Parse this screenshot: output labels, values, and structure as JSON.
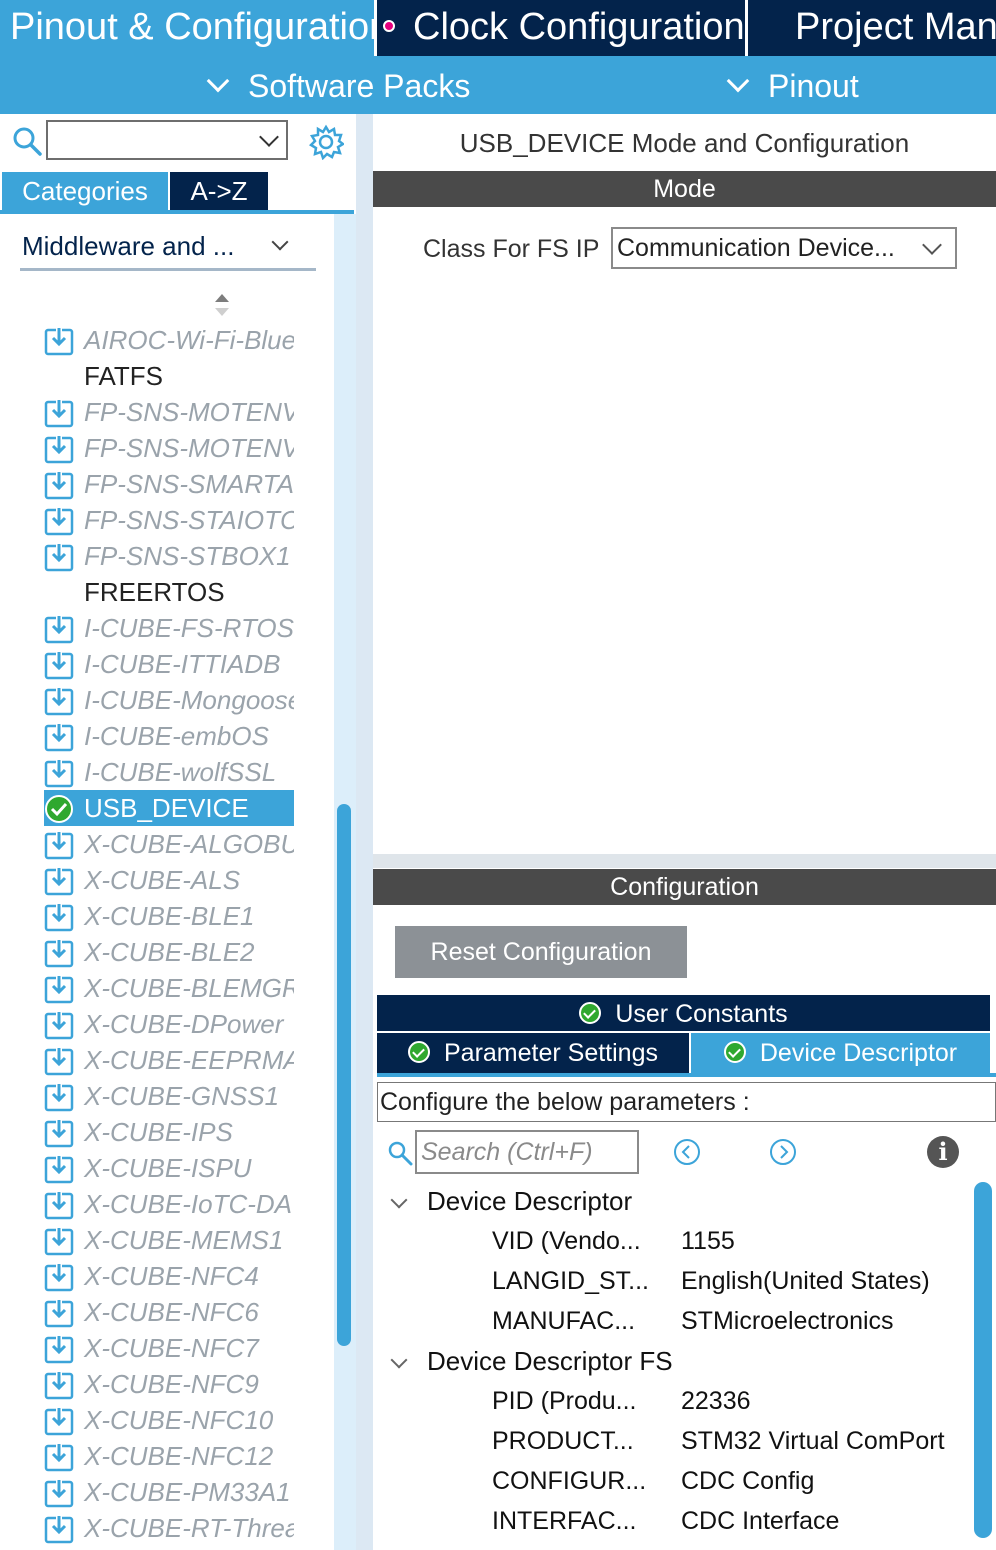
{
  "top_tabs": [
    {
      "label": "Pinout & Configuration"
    },
    {
      "label": "Clock Configuration"
    },
    {
      "label": "Project Man"
    }
  ],
  "sub_nav": [
    {
      "label": "Software Packs"
    },
    {
      "label": "Pinout"
    }
  ],
  "left": {
    "search_value": "",
    "category_tabs": [
      {
        "label": "Categories"
      },
      {
        "label": "A->Z"
      }
    ],
    "category_select": "Middleware and ...",
    "items": [
      {
        "label": "AIROC-Wi-Fi-Blue",
        "state": "download"
      },
      {
        "label": "FATFS",
        "state": "plain"
      },
      {
        "label": "FP-SNS-MOTENV",
        "state": "download"
      },
      {
        "label": "FP-SNS-MOTENV",
        "state": "download"
      },
      {
        "label": "FP-SNS-SMARTA",
        "state": "download"
      },
      {
        "label": "FP-SNS-STAIOTC",
        "state": "download"
      },
      {
        "label": "FP-SNS-STBOX1",
        "state": "download"
      },
      {
        "label": "FREERTOS",
        "state": "plain"
      },
      {
        "label": "I-CUBE-FS-RTOS",
        "state": "download"
      },
      {
        "label": "I-CUBE-ITTIADB",
        "state": "download"
      },
      {
        "label": "I-CUBE-Mongoose",
        "state": "download"
      },
      {
        "label": "I-CUBE-embOS",
        "state": "download"
      },
      {
        "label": "I-CUBE-wolfSSL",
        "state": "download"
      },
      {
        "label": "USB_DEVICE",
        "state": "selected"
      },
      {
        "label": "X-CUBE-ALGOBU",
        "state": "download"
      },
      {
        "label": "X-CUBE-ALS",
        "state": "download"
      },
      {
        "label": "X-CUBE-BLE1",
        "state": "download"
      },
      {
        "label": "X-CUBE-BLE2",
        "state": "download"
      },
      {
        "label": "X-CUBE-BLEMGR",
        "state": "download"
      },
      {
        "label": "X-CUBE-DPower",
        "state": "download"
      },
      {
        "label": "X-CUBE-EEPRMA",
        "state": "download"
      },
      {
        "label": "X-CUBE-GNSS1",
        "state": "download"
      },
      {
        "label": "X-CUBE-IPS",
        "state": "download"
      },
      {
        "label": "X-CUBE-ISPU",
        "state": "download"
      },
      {
        "label": "X-CUBE-IoTC-DA",
        "state": "download"
      },
      {
        "label": "X-CUBE-MEMS1",
        "state": "download"
      },
      {
        "label": "X-CUBE-NFC4",
        "state": "download"
      },
      {
        "label": "X-CUBE-NFC6",
        "state": "download"
      },
      {
        "label": "X-CUBE-NFC7",
        "state": "download"
      },
      {
        "label": "X-CUBE-NFC9",
        "state": "download"
      },
      {
        "label": "X-CUBE-NFC10",
        "state": "download"
      },
      {
        "label": "X-CUBE-NFC12",
        "state": "download"
      },
      {
        "label": "X-CUBE-PM33A1",
        "state": "download"
      },
      {
        "label": "X-CUBE-RT-Threa",
        "state": "download"
      }
    ]
  },
  "right": {
    "title": "USB_DEVICE Mode and Configuration",
    "mode_header": "Mode",
    "class_label": "Class For FS IP",
    "class_value": "Communication Device...",
    "config_header": "Configuration",
    "reset_label": "Reset Configuration",
    "user_constants_tab": "User Constants",
    "parameter_settings_tab": "Parameter Settings",
    "device_descriptor_tab": "Device Descriptor",
    "info_text": "Configure the below parameters :",
    "search_placeholder": "Search (Ctrl+F)",
    "groups": [
      {
        "label": "Device Descriptor",
        "params": [
          {
            "name": "VID (Vendo...",
            "value": "1155"
          },
          {
            "name": "LANGID_ST...",
            "value": "English(United States)"
          },
          {
            "name": "MANUFAC...",
            "value": "STMicroelectronics"
          }
        ]
      },
      {
        "label": "Device Descriptor FS",
        "params": [
          {
            "name": "PID (Produ...",
            "value": "22336"
          },
          {
            "name": "PRODUCT...",
            "value": "STM32 Virtual ComPort"
          },
          {
            "name": "CONFIGUR...",
            "value": "CDC Config"
          },
          {
            "name": "INTERFAC...",
            "value": "CDC Interface"
          }
        ]
      }
    ]
  },
  "colors": {
    "accent": "#3ca4d9",
    "navy": "#03234b",
    "section_header": "#4a4a4a",
    "check_green": "#2fa82f"
  }
}
